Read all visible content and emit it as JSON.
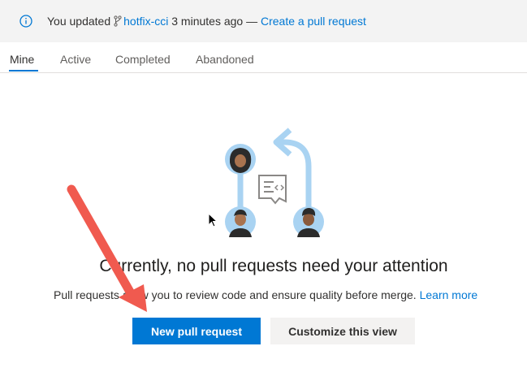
{
  "banner": {
    "prefix": "You updated",
    "branch": "hotfix-cci",
    "time": "3 minutes ago —",
    "link": "Create a pull request",
    "icon": "info-icon"
  },
  "tabs": [
    {
      "label": "Mine",
      "active": true
    },
    {
      "label": "Active",
      "active": false
    },
    {
      "label": "Completed",
      "active": false
    },
    {
      "label": "Abandoned",
      "active": false
    }
  ],
  "empty_state": {
    "heading": "Currently, no pull requests need your attention",
    "description": "Pull requests allow you to review code and ensure quality before merge.",
    "learn_more": "Learn more"
  },
  "buttons": {
    "new_pr": "New pull request",
    "customize": "Customize this view"
  },
  "colors": {
    "accent": "#0078d4",
    "annotation_arrow": "#f05a4f"
  }
}
